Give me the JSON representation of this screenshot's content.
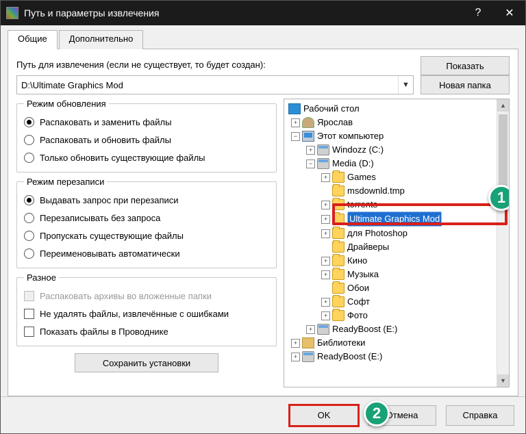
{
  "window": {
    "title": "Путь и параметры извлечения"
  },
  "tabs": {
    "general": "Общие",
    "advanced": "Дополнительно"
  },
  "path": {
    "label": "Путь для извлечения (если не существует, то будет создан):",
    "value": "D:\\Ultimate Graphics Mod"
  },
  "buttons": {
    "show": "Показать",
    "new_folder": "Новая папка",
    "save_settings": "Сохранить установки",
    "ok": "OK",
    "cancel": "Отмена",
    "help": "Справка"
  },
  "groups": {
    "update_mode": {
      "legend": "Режим обновления",
      "opt1": "Распаковать и заменить файлы",
      "opt2": "Распаковать и обновить файлы",
      "opt3": "Только обновить существующие файлы"
    },
    "overwrite_mode": {
      "legend": "Режим перезаписи",
      "opt1": "Выдавать запрос при перезаписи",
      "opt2": "Перезаписывать без запроса",
      "opt3": "Пропускать существующие файлы",
      "opt4": "Переименовывать автоматически"
    },
    "misc": {
      "legend": "Разное",
      "chk1": "Распаковать архивы во вложенные папки",
      "chk2": "Не удалять файлы, извлечённые с ошибками",
      "chk3": "Показать файлы в Проводнике"
    }
  },
  "tree": {
    "desktop": "Рабочий стол",
    "user": "Ярослав",
    "this_pc": "Этот компьютер",
    "drive_c": "Windozz (C:)",
    "drive_d": "Media (D:)",
    "folders_d": [
      "Games",
      "msdownld.tmp",
      "torrents",
      "Ultimate Graphics Mod",
      "для Photoshop",
      "Драйверы",
      "Кино",
      "Музыка",
      "Обои",
      "Софт",
      "Фото"
    ],
    "drive_e": "ReadyBoost (E:)",
    "libraries": "Библиотеки",
    "drive_e2": "ReadyBoost (E:)"
  },
  "callouts": {
    "one": "1",
    "two": "2"
  }
}
